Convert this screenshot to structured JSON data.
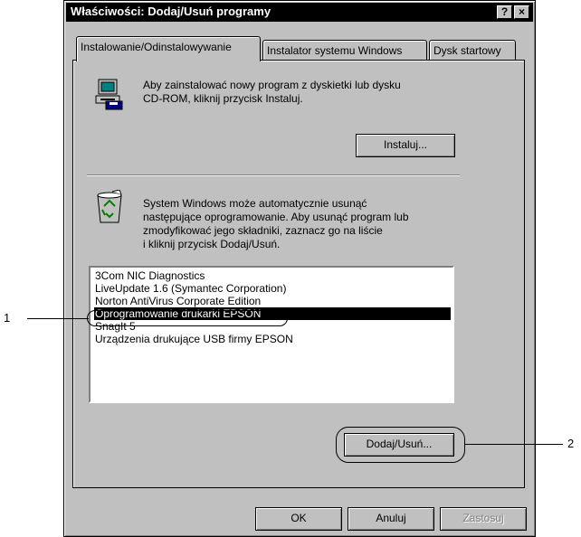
{
  "window": {
    "title": "Właściwości: Dodaj/Usuń programy",
    "help_button": "?",
    "close_button": "×"
  },
  "tabs": [
    {
      "label": "Instalowanie/Odinstalowywanie",
      "active": true
    },
    {
      "label": "Instalator systemu Windows",
      "active": false
    },
    {
      "label": "Dysk startowy",
      "active": false
    }
  ],
  "install_section": {
    "icon": "floppy-computer-icon",
    "description_lines": [
      "Aby zainstalować nowy program z dyskietki lub dysku",
      "CD-ROM, kliknij przycisk Instaluj."
    ],
    "install_button": "Instaluj..."
  },
  "remove_section": {
    "icon": "recycle-bin-icon",
    "description_lines": [
      "System Windows może automatycznie usunąć",
      "następujące oprogramowanie. Aby usunąć program lub",
      "zmodyfikować jego składniki, zaznacz go na liście",
      "i kliknij przycisk Dodaj/Usuń."
    ],
    "programs": [
      "3Com NIC Diagnostics",
      "LiveUpdate 1.6 (Symantec Corporation)",
      "Norton AntiVirus Corporate Edition",
      "Oprogramowanie drukarki EPSON",
      "SnagIt 5",
      "Urządzenia drukujące USB firmy EPSON"
    ],
    "selected_index": 3,
    "add_remove_button": "Dodaj/Usuń..."
  },
  "footer": {
    "ok_button": "OK",
    "cancel_button": "Anuluj",
    "apply_button": "Zastosuj"
  },
  "callouts": [
    "1",
    "2"
  ]
}
